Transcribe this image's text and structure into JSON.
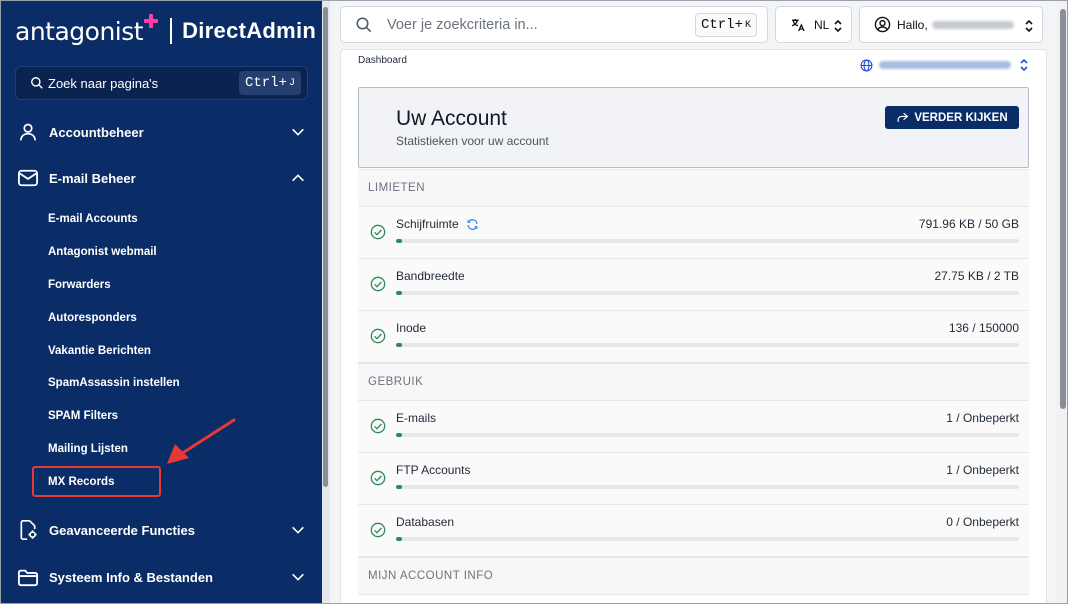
{
  "sidebar": {
    "logo_left": "antagonist",
    "logo_right": "DirectAdmin",
    "search_placeholder": "Zoek naar pagina's",
    "search_shortcut": "Ctrl+",
    "search_shortcut_key": "J",
    "groups": [
      {
        "label": "Accountbeheer",
        "icon": "user-icon",
        "expanded": false
      },
      {
        "label": "E-mail Beheer",
        "icon": "mail-icon",
        "expanded": true
      },
      {
        "label": "Geavanceerde Functies",
        "icon": "settings-doc-icon",
        "expanded": false
      },
      {
        "label": "Systeem Info & Bestanden",
        "icon": "folder-icon",
        "expanded": false
      }
    ],
    "email_items": [
      "E-mail Accounts",
      "Antagonist webmail",
      "Forwarders",
      "Autoresponders",
      "Vakantie Berichten",
      "SpamAssassin instellen",
      "SPAM Filters",
      "Mailing Lijsten",
      "MX Records"
    ],
    "highlighted_item": "MX Records"
  },
  "topbar": {
    "search_placeholder": "Voer je zoekcriteria in...",
    "search_shortcut": "Ctrl+",
    "search_shortcut_key": "K",
    "language": "NL",
    "greeting": "Hallo,"
  },
  "breadcrumb": "Dashboard",
  "account": {
    "title": "Uw Account",
    "subtitle": "Statistieken voor uw account",
    "button_label": "VERDER KIJKEN"
  },
  "sections": {
    "limits": "LIMIETEN",
    "usage": "GEBRUIK",
    "account_info": "MIJN ACCOUNT INFO"
  },
  "limits": [
    {
      "label": "Schijfruimte",
      "value": "791.96 KB / 50 GB",
      "has_refresh": true,
      "fill_fraction": 0.01
    },
    {
      "label": "Bandbreedte",
      "value": "27.75 KB / 2 TB",
      "has_refresh": false,
      "fill_fraction": 0.01
    },
    {
      "label": "Inode",
      "value": "136 / 150000",
      "has_refresh": false,
      "fill_fraction": 0.01
    }
  ],
  "usage": [
    {
      "label": "E-mails",
      "value": "1 / Onbeperkt",
      "fill_fraction": 0.01
    },
    {
      "label": "FTP Accounts",
      "value": "1 / Onbeperkt",
      "fill_fraction": 0.01
    },
    {
      "label": "Databasen",
      "value": "0 / Onbeperkt",
      "fill_fraction": 0.01
    }
  ],
  "colors": {
    "sidebar_bg": "#0b2d67",
    "brand_pink": "#ff3fa0",
    "check_green": "#2e8b57",
    "highlight_red": "#e53935"
  }
}
